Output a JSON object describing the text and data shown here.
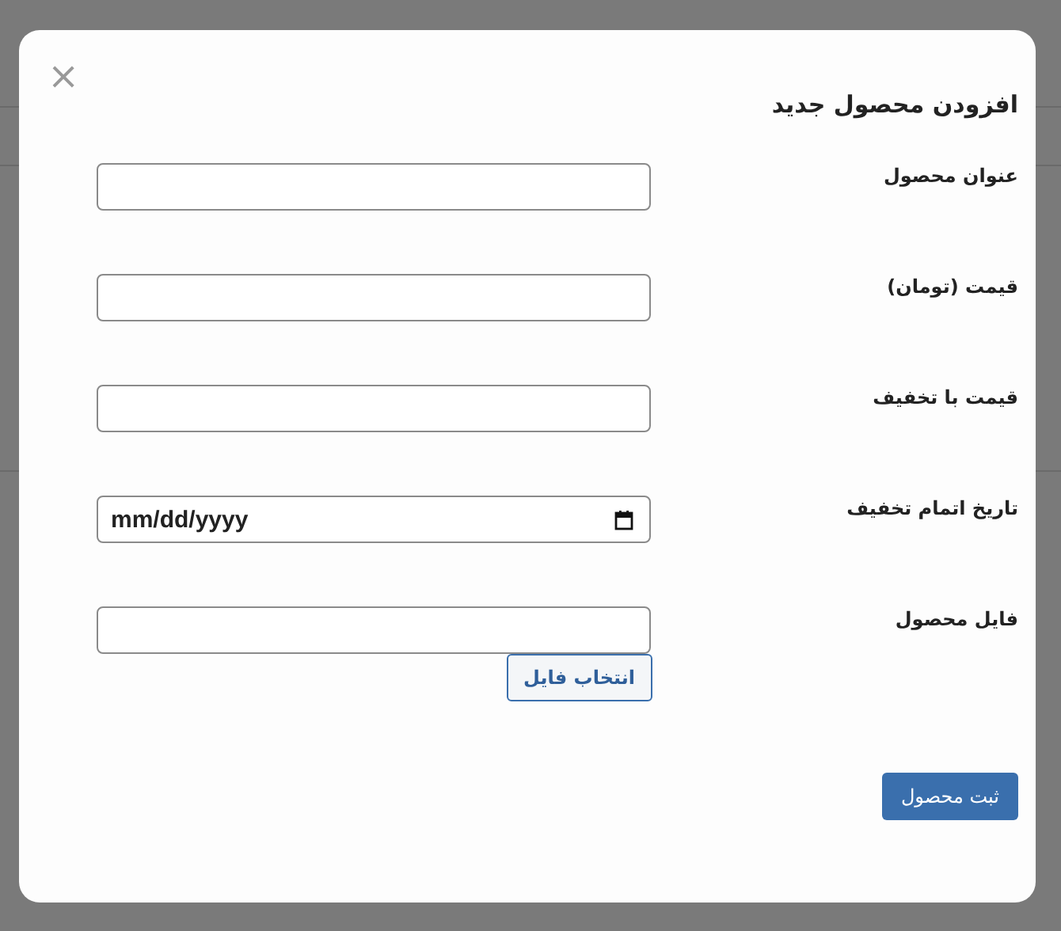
{
  "dialog": {
    "title": "افزودن محصول جدید",
    "close": "×"
  },
  "fields": [
    {
      "kind": "text",
      "label": "عنوان محصول"
    },
    {
      "kind": "text",
      "label": "قیمت (تومان)"
    },
    {
      "kind": "text",
      "label": "قیمت با تخفیف"
    },
    {
      "kind": "date",
      "label": "تاریخ اتمام تخفیف",
      "value": "mm/dd/yyyy"
    },
    {
      "kind": "file",
      "label": "فایل محصول",
      "button": "انتخاب فایل"
    }
  ],
  "submit": "ثبت محصول"
}
